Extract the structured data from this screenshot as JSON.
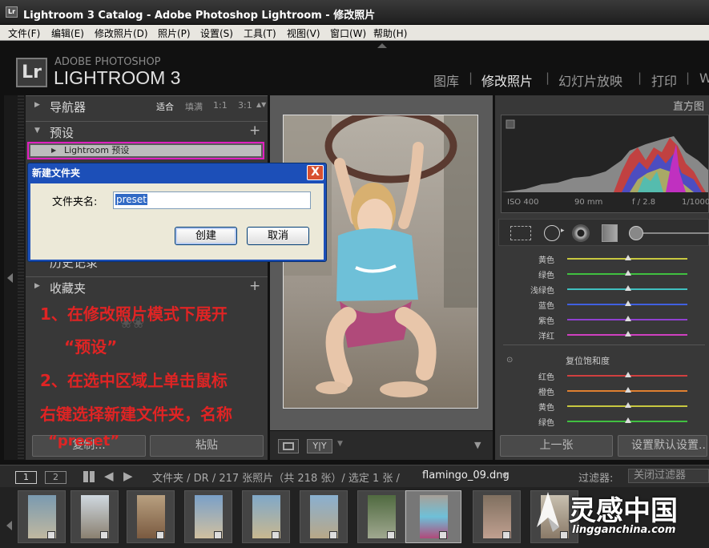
{
  "window": {
    "title": "Lightroom 3 Catalog - Adobe Photoshop Lightroom - 修改照片",
    "app_icon": "Lr"
  },
  "menu": [
    "文件(F)",
    "编辑(E)",
    "修改照片(D)",
    "照片(P)",
    "设置(S)",
    "工具(T)",
    "视图(V)",
    "窗口(W)",
    "帮助(H)"
  ],
  "brand": {
    "logo": "Lr",
    "line1": "ADOBE PHOTOSHOP",
    "line2": "LIGHTROOM 3"
  },
  "modules": [
    {
      "label": "图库",
      "active": false
    },
    {
      "label": "修改照片",
      "active": true
    },
    {
      "label": "幻灯片放映",
      "active": false
    },
    {
      "label": "打印",
      "active": false
    },
    {
      "label": "W",
      "active": false
    }
  ],
  "left": {
    "navigator": {
      "label": "导航器",
      "options": [
        "适合",
        "填满",
        "1:1",
        "3:1"
      ]
    },
    "presets": {
      "label": "预设",
      "plus": "+",
      "lr_presets": "Lightroom 预设"
    },
    "history_partial": "历史记录",
    "collections": {
      "label": "收藏夹",
      "plus": "+"
    },
    "copy_button": "复制...",
    "paste_button": "粘贴"
  },
  "instructions": {
    "line1": "1、在修改照片模式下展开",
    "line2": "“预设”",
    "line3": "2、在选中区域上单击鼠标",
    "line4": "右键选择新建文件夹，名称",
    "line5": "“preset”"
  },
  "dialog": {
    "title": "新建文件夹",
    "close": "X",
    "label": "文件夹名:",
    "value": "preset",
    "create": "创建",
    "cancel": "取消"
  },
  "right": {
    "histogram_label": "直方图",
    "exif": [
      "ISO 400",
      "90 mm",
      "f / 2.8",
      "1/1000"
    ],
    "hsl_top": [
      {
        "label": "黄色",
        "color": "#c8c840"
      },
      {
        "label": "绿色",
        "color": "#40c040"
      },
      {
        "label": "浅绿色",
        "color": "#40c0c0"
      },
      {
        "label": "蓝色",
        "color": "#4060e0"
      },
      {
        "label": "紫色",
        "color": "#9040d0"
      },
      {
        "label": "洋红",
        "color": "#d040c0"
      }
    ],
    "saturation_header": "复位饱和度",
    "hsl_bottom": [
      {
        "label": "红色",
        "color": "#d04040"
      },
      {
        "label": "橙色",
        "color": "#e08030"
      },
      {
        "label": "黄色",
        "color": "#c8c840"
      },
      {
        "label": "绿色",
        "color": "#40c040"
      }
    ],
    "prev_button": "上一张",
    "default_button": "设置默认设置..."
  },
  "filmbar": {
    "page1": "1",
    "page2": "2",
    "path": "文件夹 / DR / 217 张照片（共 218 张）/ 选定 1 张 /",
    "filename": "flamingo_09.dng",
    "filter_label": "过滤器:",
    "filter_value": "关闭过滤器"
  },
  "watermark": {
    "cn": "灵感中国",
    "url": "lingganchina.com"
  },
  "colors": {
    "highlight_border": "#e020c0",
    "instruction_red": "#e02424",
    "dialog_blue": "#1c4fb8"
  }
}
